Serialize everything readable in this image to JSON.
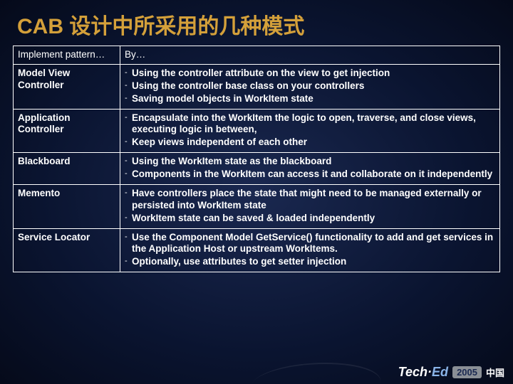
{
  "title": "CAB 设计中所采用的几种模式",
  "headers": {
    "pattern": "Implement pattern…",
    "by": "By…"
  },
  "rows": [
    {
      "pattern": "Model View Controller",
      "bullets": [
        "Using the controller attribute on the view to get injection",
        "Using the controller base class on your controllers",
        "Saving model objects in WorkItem state"
      ]
    },
    {
      "pattern": "Application Controller",
      "bullets": [
        "Encapsulate into the WorkItem the logic to open, traverse, and close views, executing logic in between,",
        "Keep views independent of each other"
      ]
    },
    {
      "pattern": "Blackboard",
      "bullets": [
        "Using the WorkItem state as the blackboard",
        "Components in the WorkItem can access it and collaborate on it independently"
      ]
    },
    {
      "pattern": "Memento",
      "bullets": [
        "Have controllers place the state that might need to be managed externally or persisted into WorkItem state",
        "WorkItem state can be saved & loaded independently"
      ]
    },
    {
      "pattern": "Service Locator",
      "bullets": [
        "Use the Component Model GetService() functionality to add and get services in the Application Host or upstream WorkItems.",
        "Optionally, use attributes to get setter injection"
      ]
    }
  ],
  "footer": {
    "brand_a": "Tech·",
    "brand_b": "Ed",
    "year": "2005",
    "cn": "中国"
  }
}
